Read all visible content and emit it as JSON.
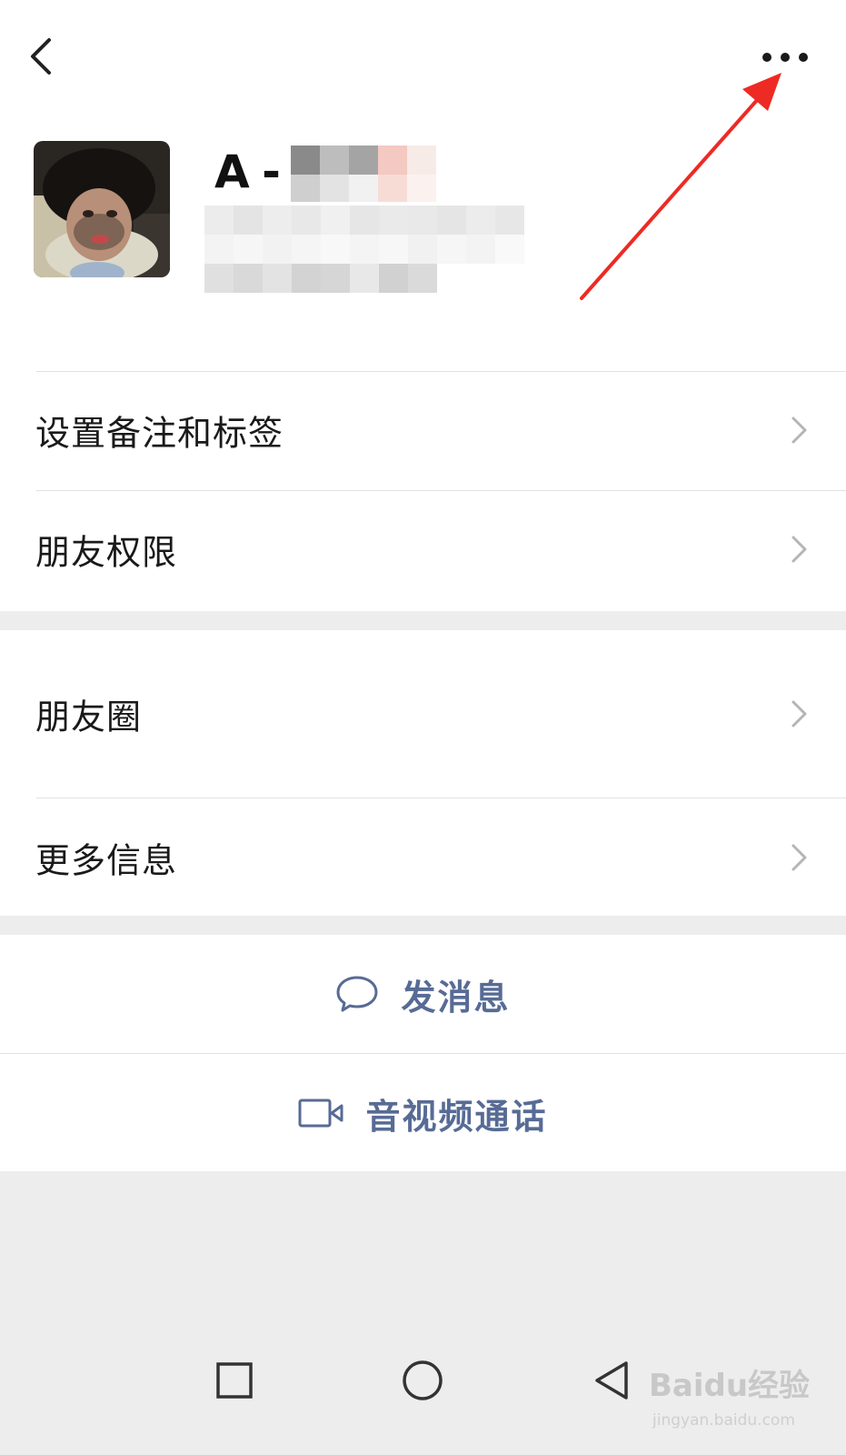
{
  "top_bar": {
    "back_icon": "chevron-left-icon",
    "more_icon": "more-dots-icon"
  },
  "profile": {
    "name_visible": "A -"
  },
  "menu_section_1": [
    {
      "label": "设置备注和标签"
    },
    {
      "label": "朋友权限"
    }
  ],
  "menu_section_2": [
    {
      "label": "朋友圈"
    },
    {
      "label": "更多信息"
    }
  ],
  "actions": {
    "message_label": "发消息",
    "call_label": "音视频通话"
  },
  "colors": {
    "link_blue": "#576b95",
    "annotation_red": "#ee2a24",
    "page_bg": "#ededed"
  },
  "watermark": {
    "brand": "Baidu经验",
    "url": "jingyan.baidu.com"
  }
}
